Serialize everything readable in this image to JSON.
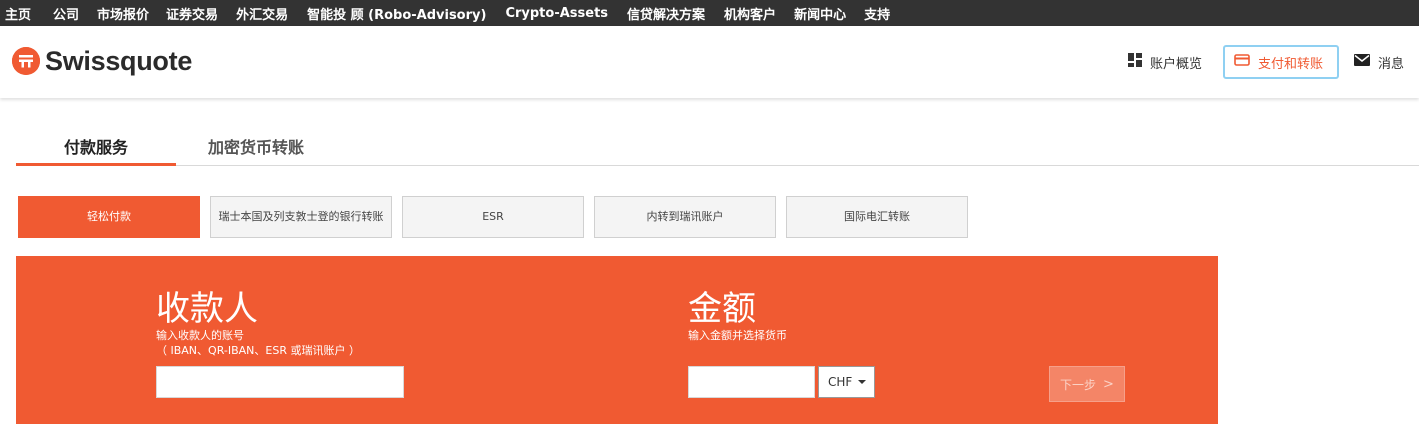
{
  "topnav": {
    "items": [
      "主页",
      "公司",
      "市场报价",
      "证券交易",
      "外汇交易",
      "智能投 顾 (Robo-Advisory)",
      "Crypto-Assets",
      "信贷解决方案",
      "机构客户",
      "新闻中心",
      "支持"
    ]
  },
  "header": {
    "logo_text": "Swissquote",
    "account_overview": "账户概览",
    "payments_transfers": "支付和转账",
    "messages": "消息"
  },
  "tabs": [
    "付款服务",
    "加密货币转账"
  ],
  "subtabs": [
    "轻松付款",
    "瑞士本国及列支敦士登的银行转账",
    "ESR",
    "内转到瑞讯账户",
    "国际电汇转账"
  ],
  "payee": {
    "title": "收款人",
    "hint_line1": "输入收款人的账号",
    "hint_line2": "（ IBAN、QR-IBAN、ESR 或瑞讯账户 ）",
    "value": ""
  },
  "amount": {
    "title": "金额",
    "hint": "输入金额并选择货币",
    "value": "",
    "currency": "CHF"
  },
  "next_button": "下一步",
  "colors": {
    "brand": "#f05a32",
    "topbar": "#333333",
    "focus": "#8fd0f2"
  }
}
